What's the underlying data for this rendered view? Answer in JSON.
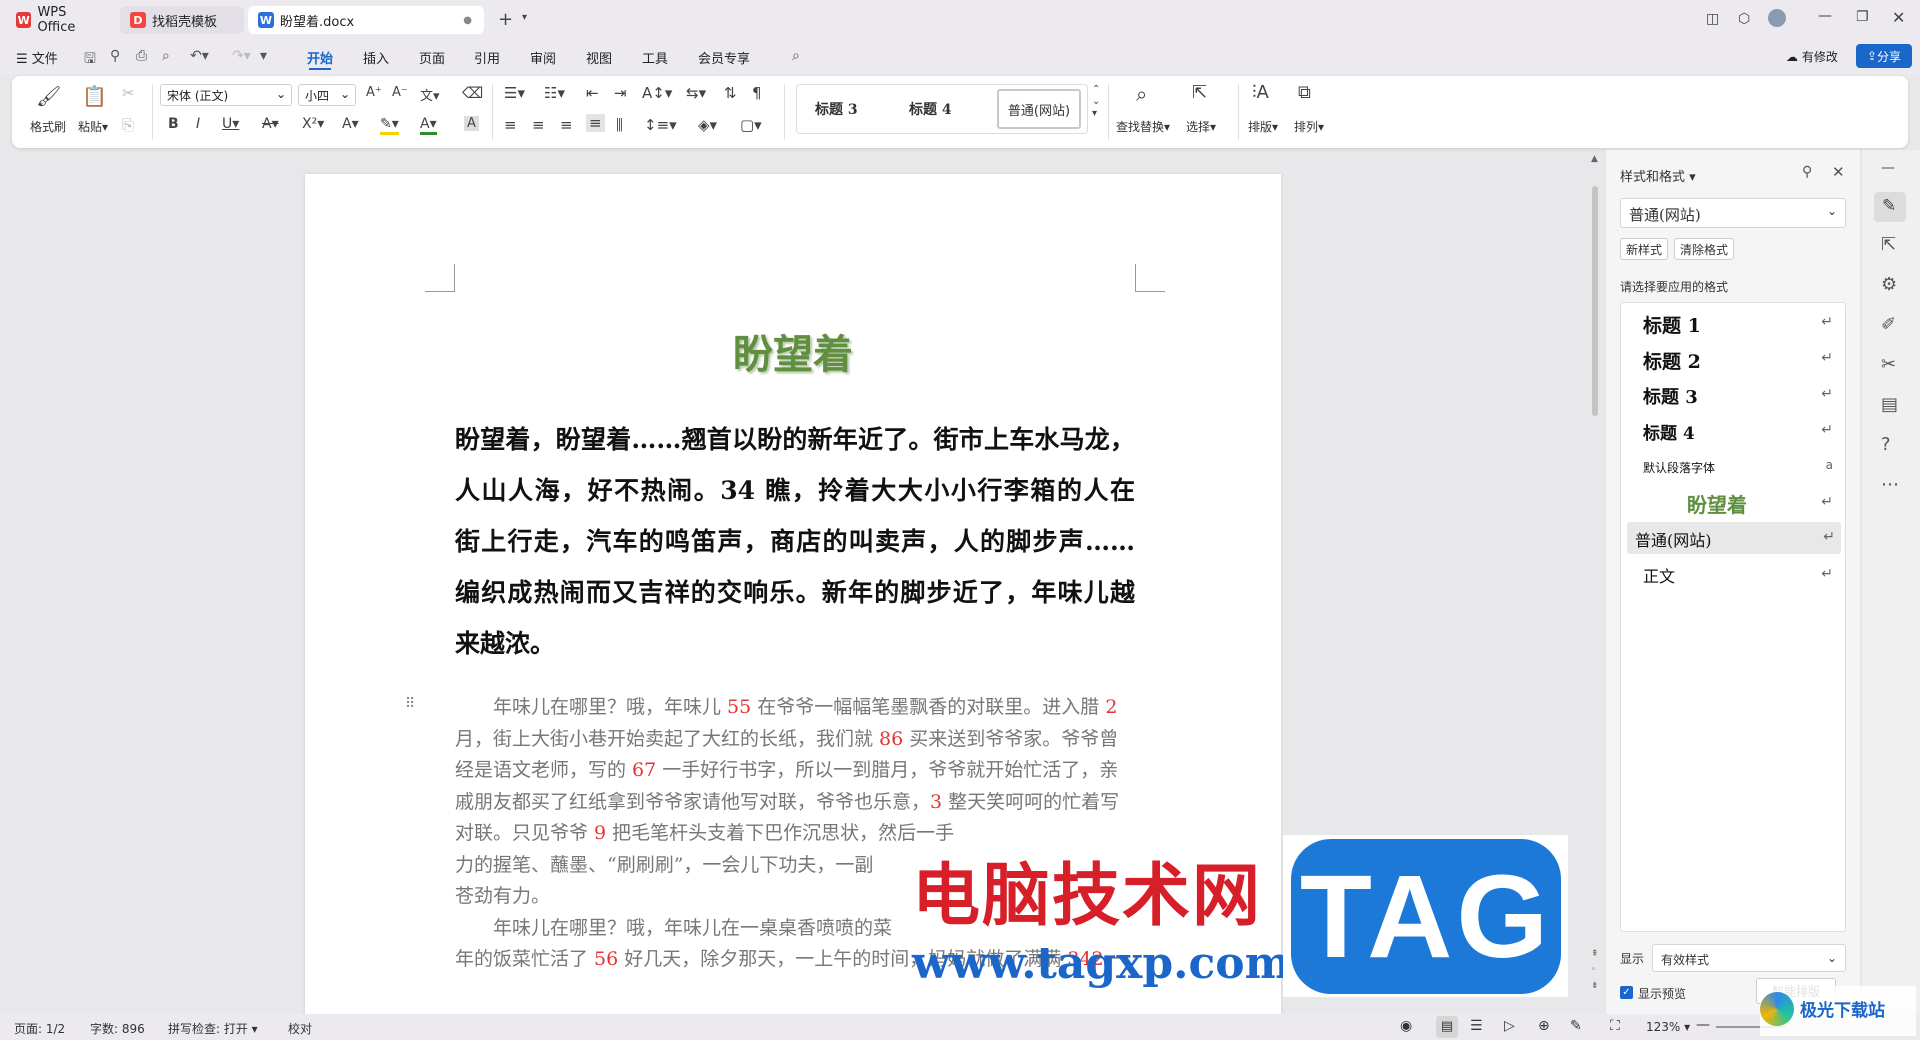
{
  "tabs": [
    {
      "label": "WPS Office"
    },
    {
      "label": "找稻壳模板"
    },
    {
      "label": "盼望着.docx"
    }
  ],
  "menu": {
    "file": "文件",
    "items": [
      "开始",
      "插入",
      "页面",
      "引用",
      "审阅",
      "视图",
      "工具",
      "会员专享"
    ],
    "status": "有修改",
    "share": "分享"
  },
  "ribbon": {
    "format_painter": "格式刷",
    "paste": "粘贴",
    "font": "宋体 (正文)",
    "size": "小四",
    "styles": [
      "标题 3",
      "标题 4",
      "普通(网站)"
    ],
    "find_replace": "查找替换",
    "select": "选择",
    "arrange": "排版",
    "order": "排列"
  },
  "document": {
    "title": "盼望着",
    "intro_lines": [
      "盼望着，盼望着……翘首以盼的新年近了。街市上车水马龙，",
      "人山人海，好不热闹。34 瞧，拎着大大小小行李箱的人在",
      "街上行走，汽车的鸣笛声，商店的叫卖声，人的脚步声……",
      "编织成热闹而又吉祥的交响乐。新年的脚步近了，年味儿越",
      "来越浓。"
    ],
    "body_lines": [
      [
        {
          "t": "　　年味儿在哪里？哦，年味儿 "
        },
        {
          "t": "55",
          "r": true
        },
        {
          "t": " 在爷爷一幅幅笔墨飘香的对联里。进入腊 "
        },
        {
          "t": "2",
          "r": true
        }
      ],
      [
        {
          "t": "月，街上大街小巷开始卖起了大红的长纸，我们就 "
        },
        {
          "t": "86",
          "r": true
        },
        {
          "t": " 买来送到爷爷家。爷爷曾"
        }
      ],
      [
        {
          "t": "经是语文老师，写的 "
        },
        {
          "t": "67",
          "r": true
        },
        {
          "t": " 一手好行书字，所以一到腊月，爷爷就开始忙活了，亲"
        }
      ],
      [
        {
          "t": "戚朋友都买了红纸拿到爷爷家请他写对联，爷爷也乐意，"
        },
        {
          "t": "3",
          "r": true
        },
        {
          "t": " 整天笑呵呵的忙着写"
        }
      ],
      [
        {
          "t": "对联。只见爷爷 "
        },
        {
          "t": "9",
          "r": true
        },
        {
          "t": " 把毛笔杆头支着下巴作沉思状，然后一手"
        }
      ],
      [
        {
          "t": "力的握笔、蘸墨、“刷刷刷”，一会儿下功夫，一副"
        }
      ],
      [
        {
          "t": "苍劲有力。"
        }
      ],
      [
        {
          "t": "　　年味儿在哪里？哦，年味儿在一桌桌香喷喷的菜"
        }
      ],
      [
        {
          "t": "年的饭菜忙活了 "
        },
        {
          "t": "56",
          "r": true
        },
        {
          "t": " 好几天，除夕那天，一上午的时间，妈妈就做了满满 "
        },
        {
          "t": "342",
          "r": true
        },
        {
          "t": " 一"
        }
      ]
    ]
  },
  "sidepanel": {
    "title": "样式和格式",
    "current": "普通(网站)",
    "new_style": "新样式",
    "clear_format": "清除格式",
    "hint": "请选择要应用的格式",
    "styles": [
      "标题 1",
      "标题 2",
      "标题 3",
      "标题 4",
      "默认段落字体",
      "盼望着",
      "普通(网站)",
      "正文"
    ],
    "show_label": "显示",
    "show_value": "有效样式",
    "preview": "显示预览",
    "smart": "智能排版"
  },
  "status": {
    "page": "页面: 1/2",
    "words": "字数: 896",
    "spell": "拼写检查: 打开",
    "proof": "校对",
    "zoom": "123%"
  },
  "watermark": {
    "cn": "电脑技术网",
    "url": "www.tagxp.com",
    "tag": "TAG",
    "site": "极光下载站"
  },
  "colors": {
    "accent": "#1a66c9",
    "title_green": "#5f8f3f",
    "number_red": "#e53333"
  }
}
